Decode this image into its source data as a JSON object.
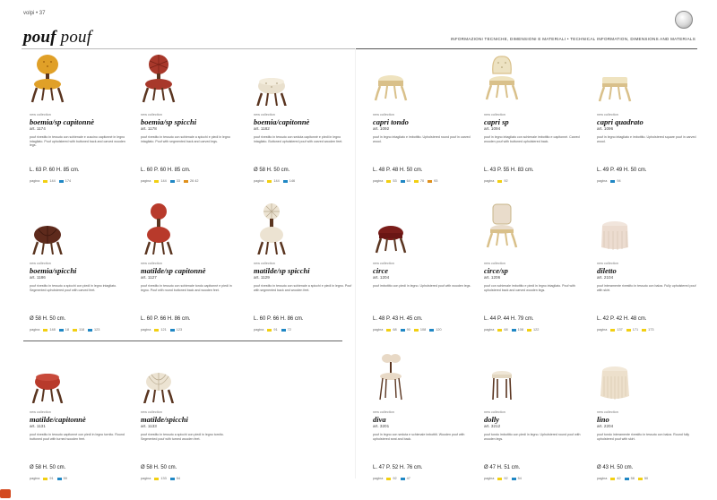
{
  "header": {
    "page_label": "volpi • 37",
    "title_main": "pouf",
    "title_sub": "pouf",
    "technical_info": "INFORMAZIONI TECNICHE, DIMENSIONI E MATERIALI • TECHNICAL INFORMATION, DIMENSIONS AND MATERIALS"
  },
  "colors": {
    "yellow": "#f2cf12",
    "blue": "#1f87c4",
    "orange": "#e0901c",
    "brand": "#d34a1f"
  },
  "products": [
    {
      "name": "boemia/sp capitonnè",
      "art": "art. 1174",
      "tag": "new collection",
      "desc": "pouf rivestito in tessuto con schienale e cuscino capitonnè in legno intagliato. Pouf upholstered with buttoned back and carved wooden legs.",
      "dims": "L. 63 P. 60 H. 85 cm.",
      "finish": "pagina",
      "swatch_text": [
        "144",
        "174"
      ],
      "swatch_colors": [
        "yellow",
        "blue"
      ]
    },
    {
      "name": "boemia/sp spicchi",
      "art": "art. 1178",
      "tag": "new collection",
      "desc": "pouf rivestito in tessuto con schienale a spicchi e piedi in legno intagliato. Pouf with segmented back and carved legs.",
      "dims": "L. 60 P. 60 H. 85 cm.",
      "finish": "pagina",
      "swatch_text": [
        "144",
        "33",
        "26 42"
      ],
      "swatch_colors": [
        "yellow",
        "blue",
        "orange"
      ]
    },
    {
      "name": "boemia/capitonnè",
      "art": "art. 1182",
      "tag": "new collection",
      "desc": "pouf rivestito in tessuto con seduta capitonnè e piedi in legno intagliato. Buttoned upholstered pouf with carved wooden feet.",
      "dims": "Ø 58 H. 50 cm.",
      "finish": "pagina",
      "swatch_text": [
        "144",
        "146"
      ],
      "swatch_colors": [
        "yellow",
        "blue"
      ]
    },
    {
      "name": "capri tondo",
      "art": "art. 1092",
      "tag": "new collection",
      "desc": "pouf in legno intagliato e imbottito. Upholstered round pouf in carved wood.",
      "dims": "L. 48 P. 48 H. 50 cm.",
      "finish": "pagina",
      "swatch_text": [
        "53",
        "64",
        "70",
        "93"
      ],
      "swatch_colors": [
        "yellow",
        "blue",
        "yellow",
        "orange"
      ]
    },
    {
      "name": "capri sp",
      "art": "art. 1094",
      "tag": "new collection",
      "desc": "pouf in legno intagliato con schienale imbottito e capitonnè. Carved wooden pouf with buttoned upholstered back.",
      "dims": "L. 43 P. 55 H. 83 cm.",
      "finish": "pagina",
      "swatch_text": [
        "92"
      ],
      "swatch_colors": [
        "yellow"
      ]
    },
    {
      "name": "capri quadrato",
      "art": "art. 1096",
      "tag": "new collection",
      "desc": "pouf in legno intagliato e imbottito. Upholstered square pouf in carved wood.",
      "dims": "L. 49 P. 49 H. 50 cm.",
      "finish": "pagina",
      "swatch_text": [
        "94"
      ],
      "swatch_colors": [
        "blue"
      ]
    },
    {
      "name": "boemia/spicchi",
      "art": "art. 1186",
      "tag": "new collection",
      "desc": "pouf rivestito in tessuto a spicchi con piedi in legno intagliato. Segmented upholstered pouf with carved feet.",
      "dims": "Ø 58 H. 50 cm.",
      "finish": "pagina",
      "swatch_text": [
        "148",
        "18",
        "118",
        "123"
      ],
      "swatch_colors": [
        "yellow",
        "blue"
      ]
    },
    {
      "name": "matilde/sp capitonnè",
      "art": "art. 1127",
      "tag": "new collection",
      "desc": "pouf rivestito in tessuto con schienale tondo capitonnè e piedi in legno. Pouf with round buttoned back and wooden feet.",
      "dims": "L. 60 P. 66 H. 86 cm.",
      "finish": "pagina",
      "swatch_text": [
        "121",
        "123"
      ],
      "swatch_colors": [
        "yellow",
        "blue"
      ]
    },
    {
      "name": "matilde/sp spicchi",
      "art": "art. 1129",
      "tag": "new collection",
      "desc": "pouf rivestito in tessuto con schienale a spicchi e piedi in legno. Pouf with segmented back and wooden feet.",
      "dims": "L. 60 P. 66 H. 86 cm.",
      "finish": "pagina",
      "swatch_text": [
        "91",
        "72"
      ],
      "swatch_colors": [
        "yellow",
        "blue"
      ]
    },
    {
      "name": "circe",
      "art": "art. 1204",
      "tag": "new collection",
      "desc": "pouf imbottito con piedi in legno. Upholstered pouf with wooden legs.",
      "dims": "L. 48 P. 43 H. 45 cm.",
      "finish": "pagina",
      "swatch_text": [
        "68",
        "90",
        "108",
        "120"
      ],
      "swatch_colors": [
        "yellow",
        "blue"
      ]
    },
    {
      "name": "circe/sp",
      "art": "art. 1206",
      "tag": "new collection",
      "desc": "pouf con schienale imbottito e piedi in legno intagliato. Pouf with upholstered back and carved wooden legs.",
      "dims": "L. 44 P. 44 H. 79 cm.",
      "finish": "pagina",
      "swatch_text": [
        "68",
        "108",
        "122"
      ],
      "swatch_colors": [
        "yellow",
        "blue"
      ]
    },
    {
      "name": "diletto",
      "art": "art. 2104",
      "tag": "new collection",
      "desc": "pouf interamente rivestito in tessuto con balza. Fully upholstered pouf with skirt.",
      "dims": "L. 42 P. 42 H. 48 cm.",
      "finish": "pagina",
      "swatch_text": [
        "137",
        "171",
        "173"
      ],
      "swatch_colors": [
        "yellow"
      ]
    },
    {
      "name": "matilde/capitonnè",
      "art": "art. 1131",
      "tag": "new collection",
      "desc": "pouf rivestito in tessuto capitonnè con piedi in legno tornito. Round buttoned pouf with turned wooden feet.",
      "dims": "Ø 58 H. 50 cm.",
      "finish": "pagina",
      "swatch_text": [
        "91",
        "59"
      ],
      "swatch_colors": [
        "yellow",
        "blue"
      ]
    },
    {
      "name": "matilde/spicchi",
      "art": "art. 1133",
      "tag": "new collection",
      "desc": "pouf rivestito in tessuto a spicchi con piedi in legno tornito. Segmented pouf with turned wooden feet.",
      "dims": "Ø 58 H. 50 cm.",
      "finish": "pagina",
      "swatch_text": [
        "133",
        "54"
      ],
      "swatch_colors": [
        "yellow",
        "blue"
      ]
    },
    {
      "name": "diva",
      "art": "art. 3201",
      "tag": "new collection",
      "desc": "pouf in legno con seduta e schienale imbottiti. Wooden pouf with upholstered seat and back.",
      "dims": "L. 47 P. 52 H. 76 cm.",
      "finish": "pagina",
      "swatch_text": [
        "92",
        "47"
      ],
      "swatch_colors": [
        "yellow",
        "blue"
      ]
    },
    {
      "name": "dolly",
      "art": "art. 3212",
      "tag": "new collection",
      "desc": "pouf tondo imbottito con piedi in legno. Upholstered round pouf with wooden legs.",
      "dims": "Ø 47 H. 51 cm.",
      "finish": "pagina",
      "swatch_text": [
        "92",
        "54"
      ],
      "swatch_colors": [
        "yellow",
        "blue"
      ]
    },
    {
      "name": "lino",
      "art": "art. 2204",
      "tag": "new collection",
      "desc": "pouf tondo interamente rivestito in tessuto con balza. Round fully upholstered pouf with skirt.",
      "dims": "Ø 43 H. 50 cm.",
      "finish": "pagina",
      "swatch_text": [
        "42",
        "58",
        "50"
      ],
      "swatch_colors": [
        "yellow",
        "blue"
      ]
    }
  ]
}
